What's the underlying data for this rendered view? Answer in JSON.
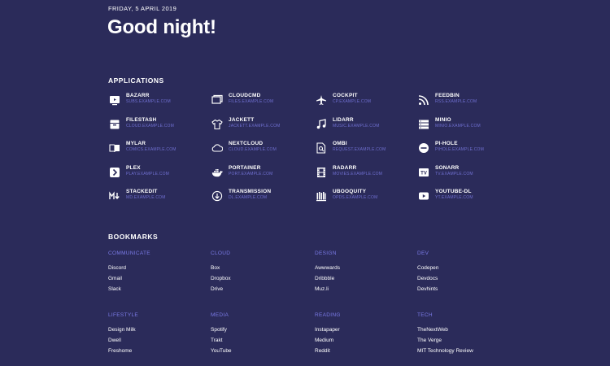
{
  "header": {
    "date": "FRIDAY, 5 APRIL 2019",
    "greeting": "Good night!"
  },
  "applications": {
    "title": "APPLICATIONS",
    "items": [
      {
        "name": "BAZARR",
        "url": "SUBS.EXAMPLE.COM",
        "icon": "tv-icon"
      },
      {
        "name": "CLOUDCMD",
        "url": "FILES.EXAMPLE.COM",
        "icon": "folders-icon"
      },
      {
        "name": "COCKPIT",
        "url": "CP.EXAMPLE.COM",
        "icon": "airplane-icon"
      },
      {
        "name": "FEEDBIN",
        "url": "RSS.EXAMPLE.COM",
        "icon": "rss-icon"
      },
      {
        "name": "FILESTASH",
        "url": "CLOUD.EXAMPLE.COM",
        "icon": "archive-icon"
      },
      {
        "name": "JACKETT",
        "url": "JACKETT.EXAMPLE.COM",
        "icon": "tshirt-icon"
      },
      {
        "name": "LIDARR",
        "url": "MUSIC.EXAMPLE.COM",
        "icon": "music-note-icon"
      },
      {
        "name": "MINIO",
        "url": "MINIO.EXAMPLE.COM",
        "icon": "server-icon"
      },
      {
        "name": "MYLAR",
        "url": "COMICS.EXAMPLE.COM",
        "icon": "book-icon"
      },
      {
        "name": "NEXTCLOUD",
        "url": "CLOUD.EXAMPLE.COM",
        "icon": "cloud-icon"
      },
      {
        "name": "OMBI",
        "url": "REQUEST.EXAMPLE.COM",
        "icon": "file-search-icon"
      },
      {
        "name": "PI-HOLE",
        "url": "PIHOLE.EXAMPLE.COM",
        "icon": "block-icon"
      },
      {
        "name": "PLEX",
        "url": "PLAY.EXAMPLE.COM",
        "icon": "plex-icon"
      },
      {
        "name": "PORTAINER",
        "url": "PORT.EXAMPLE.COM",
        "icon": "docker-icon"
      },
      {
        "name": "RADARR",
        "url": "MOVIES.EXAMPLE.COM",
        "icon": "film-icon"
      },
      {
        "name": "SONARR",
        "url": "TV.EXAMPLE.COM",
        "icon": "tv-box-icon"
      },
      {
        "name": "STACKEDIT",
        "url": "MD.EXAMPLE.COM",
        "icon": "markdown-icon"
      },
      {
        "name": "TRANSMISSION",
        "url": "DL.EXAMPLE.COM",
        "icon": "download-icon"
      },
      {
        "name": "UBOOQUITY",
        "url": "OPDS.EXAMPLE.COM",
        "icon": "bookshelf-icon"
      },
      {
        "name": "YOUTUBE-DL",
        "url": "YT.EXAMPLE.COM",
        "icon": "youtube-icon"
      }
    ]
  },
  "bookmarks": {
    "title": "BOOKMARKS",
    "groups": [
      {
        "category": "COMMUNICATE",
        "links": [
          "Discord",
          "Gmail",
          "Slack"
        ]
      },
      {
        "category": "CLOUD",
        "links": [
          "Box",
          "Dropbox",
          "Drive"
        ]
      },
      {
        "category": "DESIGN",
        "links": [
          "Awwwards",
          "Dribbble",
          "Muz.li"
        ]
      },
      {
        "category": "DEV",
        "links": [
          "Codepen",
          "Devdocs",
          "Devhints"
        ]
      },
      {
        "category": "LIFESTYLE",
        "links": [
          "Design Milk",
          "Dwell",
          "Freshome"
        ]
      },
      {
        "category": "MEDIA",
        "links": [
          "Spotify",
          "Trakt",
          "YouTube"
        ]
      },
      {
        "category": "READING",
        "links": [
          "Instapaper",
          "Medium",
          "Reddit"
        ]
      },
      {
        "category": "TECH",
        "links": [
          "TheNextWeb",
          "The Verge",
          "MIT Technology Review"
        ]
      }
    ]
  }
}
